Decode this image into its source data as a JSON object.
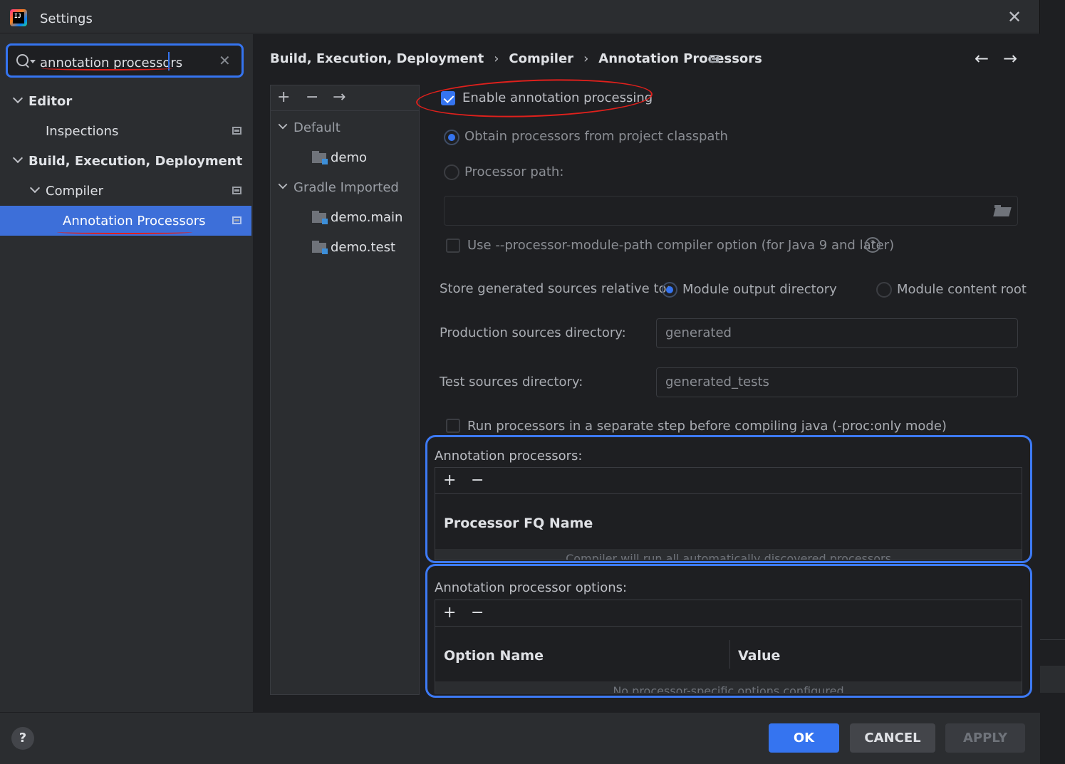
{
  "window": {
    "title": "Settings"
  },
  "search": {
    "value": "annotation processors"
  },
  "sidebar": {
    "items": [
      {
        "label": "Editor"
      },
      {
        "label": "Inspections"
      },
      {
        "label": "Build, Execution, Deployment"
      },
      {
        "label": "Compiler"
      },
      {
        "label": "Annotation Processors"
      }
    ]
  },
  "breadcrumb": {
    "items": [
      "Build, Execution, Deployment",
      "Compiler",
      "Annotation Processors"
    ],
    "separator": "›"
  },
  "modules": {
    "items": [
      {
        "label": "Default"
      },
      {
        "label": "demo"
      },
      {
        "label": "Gradle Imported"
      },
      {
        "label": "demo.main"
      },
      {
        "label": "demo.test"
      }
    ]
  },
  "options": {
    "enable_processing": "Enable annotation processing",
    "obtain_classpath": "Obtain processors from project classpath",
    "processor_path": "Processor path:",
    "use_module_path": "Use --processor-module-path compiler option (for Java 9 and later)",
    "store_relative": "Store generated sources relative to:",
    "module_output": "Module output directory",
    "module_content": "Module content root",
    "production_dir_label": "Production sources directory:",
    "production_dir_value": "generated",
    "test_dir_label": "Test sources directory:",
    "test_dir_value": "generated_tests",
    "run_separate": "Run processors in a separate step before compiling java (-proc:only mode)"
  },
  "processors_table": {
    "title": "Annotation processors:",
    "column": "Processor FQ Name",
    "empty": "Compiler will run all automatically discovered processors"
  },
  "options_table": {
    "title": "Annotation processor options:",
    "columns": [
      "Option Name",
      "Value"
    ],
    "empty": "No processor-specific options configured"
  },
  "buttons": {
    "ok": "OK",
    "cancel": "CANCEL",
    "apply": "APPLY",
    "help": "?"
  },
  "colors": {
    "accent": "#3574f0",
    "annotation_red": "#e0201c",
    "highlight_blue": "#3d7af5"
  }
}
